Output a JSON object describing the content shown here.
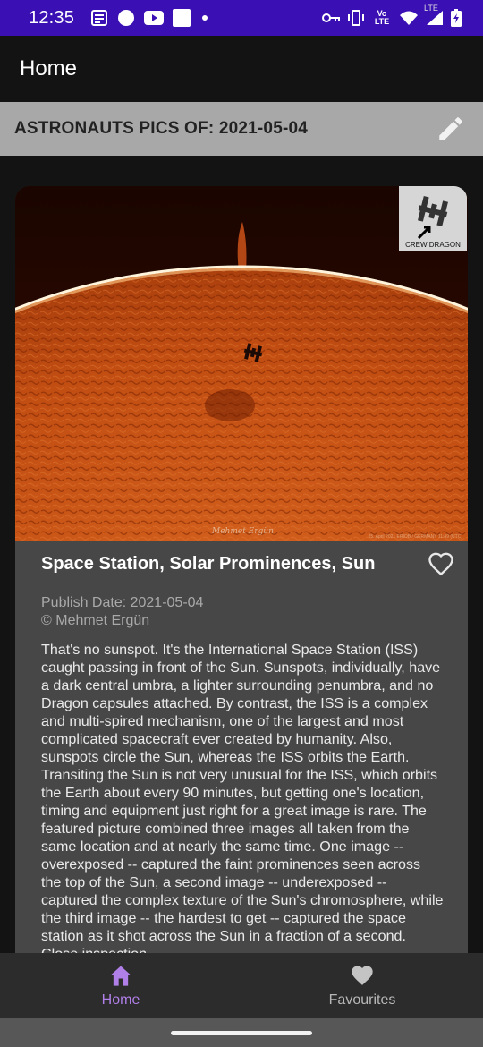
{
  "status_bar": {
    "time": "12:35",
    "left_icons": [
      "news-icon",
      "circle-icon",
      "youtube-icon",
      "square-icon",
      "dot-icon"
    ],
    "right_icons": [
      "key-icon",
      "vibrate-icon",
      "volte-icon",
      "wifi-icon",
      "lte-signal-icon",
      "battery-icon"
    ],
    "volte_text": "Vo LTE",
    "lte_text": "LTE"
  },
  "app_bar": {
    "title": "Home"
  },
  "date_header": {
    "label": "ASTRONAUTS PICS OF: 2021-05-04",
    "edit_icon": "pencil-icon"
  },
  "card": {
    "image_inset_label": "CREW DRAGON",
    "image_signature": "Mehmet Ergün",
    "image_caption": "25. April 2021 ERIOB / GERMANY 11:49 (UTC)",
    "title": "Space Station, Solar Prominences, Sun",
    "favourite_icon": "heart-outline-icon",
    "publish_date": "Publish Date: 2021-05-04",
    "copyright": "© Mehmet Ergün",
    "description": "That's no sunspot. It's the International Space Station (ISS) caught passing in front of the Sun. Sunspots, individually, have a dark central umbra, a lighter surrounding penumbra, and no Dragon capsules attached.  By contrast, the ISS is a complex and multi-spired mechanism, one of the largest and most complicated spacecraft ever created by humanity.  Also, sunspots circle the Sun, whereas the ISS orbits the Earth.  Transiting the Sun is not very unusual for the ISS, which orbits the Earth about every 90 minutes, but getting one's location, timing and equipment just right for a great image is rare.  The featured picture combined three images all taken from the same location and at nearly the same time. One image -- overexposed -- captured the faint prominences seen across the top of the Sun, a second image -- underexposed -- captured the complex texture of the Sun's chromosphere, while the third image -- the hardest to get -- captured the space station as it shot across the Sun in a fraction of a second.  Close inspection"
  },
  "bottom_nav": {
    "items": [
      {
        "label": "Home",
        "icon": "home-icon",
        "active": true
      },
      {
        "label": "Favourites",
        "icon": "heart-icon",
        "active": false
      }
    ]
  },
  "colors": {
    "status_bar": "#3a0fb4",
    "background": "#131313",
    "date_header": "#a8a8a8",
    "card": "#474747",
    "nav_active": "#b07fe8",
    "nav_inactive": "#b8b8b8"
  }
}
